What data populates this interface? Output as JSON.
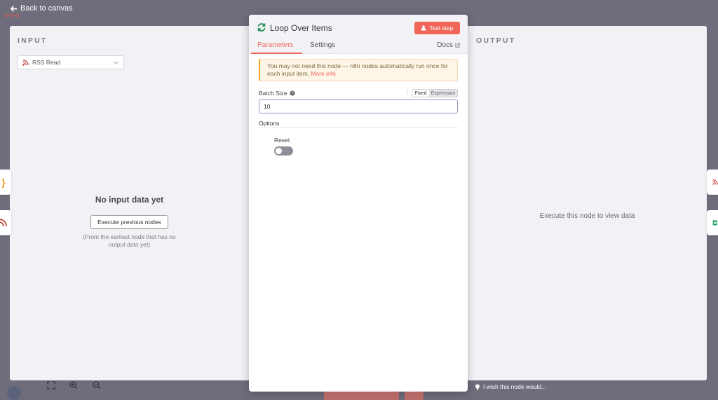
{
  "nav": {
    "back_label": "Back to canvas"
  },
  "input_panel": {
    "heading": "INPUT",
    "selected_node": "RSS Read",
    "empty_title": "No input data yet",
    "execute_button": "Execute previous nodes",
    "execute_hint": "(From the earliest node that has no output data yet)"
  },
  "output_panel": {
    "heading": "OUTPUT",
    "empty_hint": "Execute this node to view data"
  },
  "dialog": {
    "title": "Loop Over Items",
    "test_button": "Test step",
    "tabs": [
      "Parameters",
      "Settings"
    ],
    "docs_label": "Docs",
    "notice_text": "You may not need this node — n8n nodes automatically run once for each input item.",
    "notice_link": "More info",
    "batch_size": {
      "label": "Batch Size",
      "value": "10",
      "mode_fixed": "Fixed",
      "mode_expression": "Expression"
    },
    "options": {
      "title": "Options",
      "reset_label": "Reset",
      "reset_enabled": false
    }
  },
  "footer": {
    "wish_text": "I wish this node would..."
  },
  "colors": {
    "accent": "#f0675a",
    "background": "#6f6d7b",
    "panel": "#f1f1f6"
  }
}
